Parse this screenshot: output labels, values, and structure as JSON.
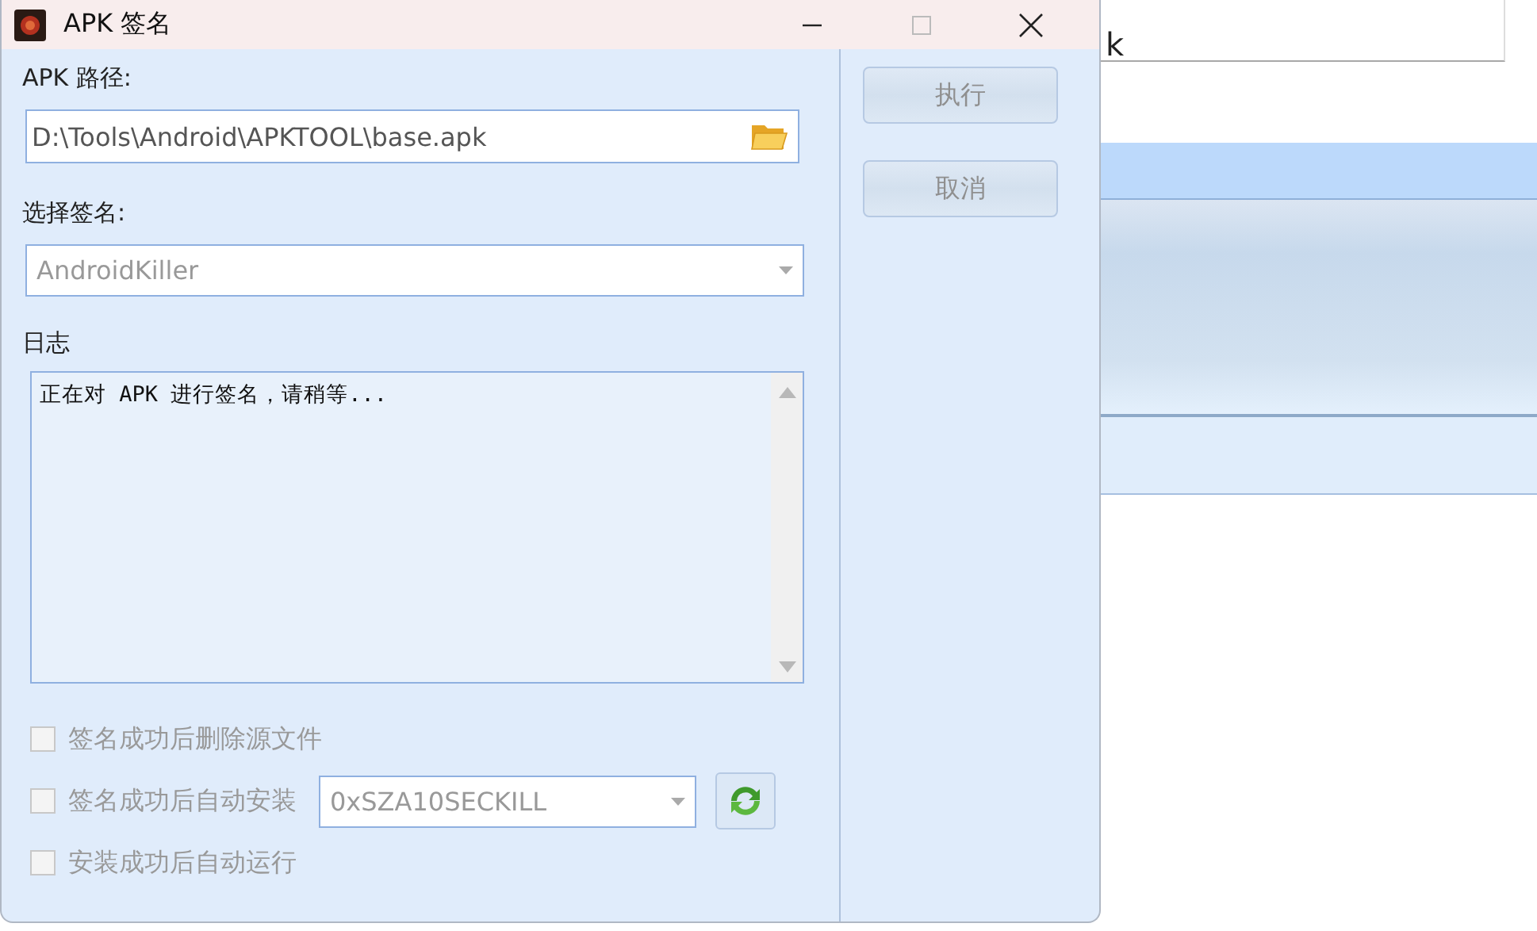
{
  "background_window": {
    "text": "k"
  },
  "dialog": {
    "title": "APK 签名",
    "apk_path": {
      "label": "APK 路径:",
      "value": "D:\\Tools\\Android\\APKTOOL\\base.apk"
    },
    "signature": {
      "label": "选择签名:",
      "value": "AndroidKiller",
      "disabled": true
    },
    "log": {
      "label": "日志",
      "text": "正在对 APK 进行签名，请稍等..."
    },
    "options": [
      {
        "kind": "checkbox",
        "label": "签名成功后删除源文件",
        "checked": false,
        "disabled": true
      },
      {
        "kind": "checkbox-device",
        "label": "签名成功后自动安装",
        "checked": false,
        "disabled": true,
        "device": "0xSZA10SECKILL"
      },
      {
        "kind": "checkbox",
        "label": "安装成功后自动运行",
        "checked": false,
        "disabled": true
      }
    ],
    "buttons": [
      {
        "label": "执行",
        "disabled": true
      },
      {
        "label": "取消",
        "disabled": true
      }
    ]
  }
}
